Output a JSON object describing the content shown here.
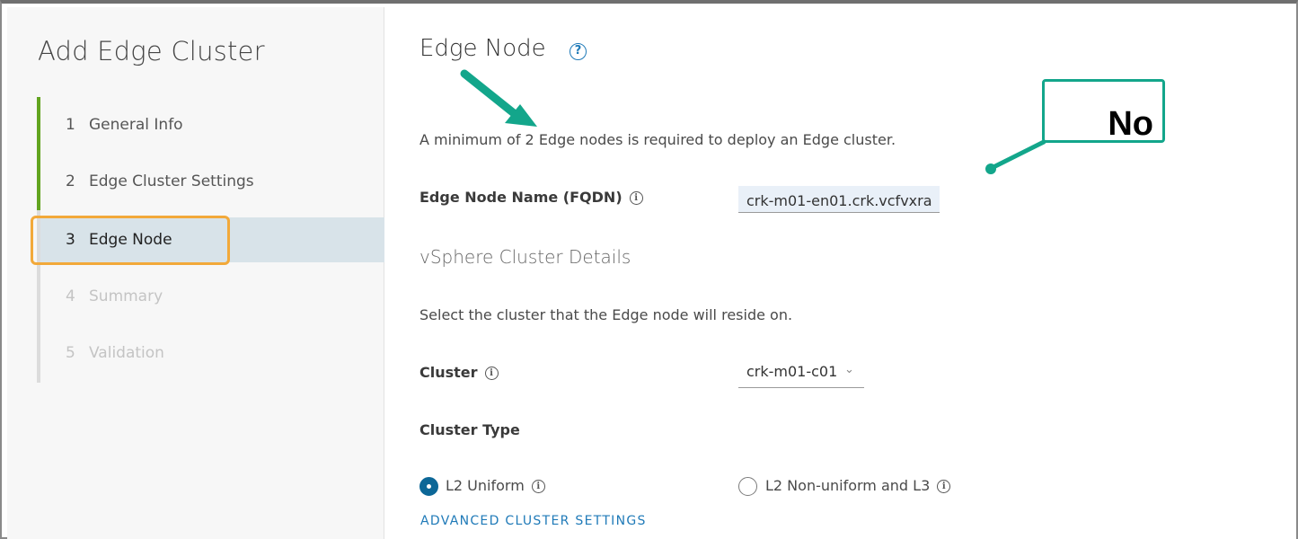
{
  "wizard": {
    "title": "Add Edge Cluster",
    "steps": [
      {
        "num": "1",
        "label": "General Info",
        "state": "completed"
      },
      {
        "num": "2",
        "label": "Edge Cluster Settings",
        "state": "completed"
      },
      {
        "num": "3",
        "label": "Edge Node",
        "state": "active"
      },
      {
        "num": "4",
        "label": "Summary",
        "state": "disabled"
      },
      {
        "num": "5",
        "label": "Validation",
        "state": "disabled"
      }
    ]
  },
  "main": {
    "title": "Edge Node",
    "help_icon": "?",
    "min_text": "A minimum of 2 Edge nodes is required to deploy an Edge cluster.",
    "fqdn_label": "Edge Node Name (FQDN)",
    "fqdn_value": "crk-m01-en01.crk.vcfvxra",
    "vsphere_title": "vSphere Cluster Details",
    "select_text": "Select the cluster that the Edge node will reside on.",
    "cluster_label": "Cluster",
    "cluster_value": "crk-m01-c01",
    "cluster_type_label": "Cluster Type",
    "radio_l2_uniform": "L2 Uniform",
    "radio_l2_nonuniform": "L2 Non-uniform and L3",
    "advanced_link": "ADVANCED CLUSTER SETTINGS"
  },
  "annotation": {
    "callout_text": "No",
    "color": "#13a68b",
    "highlight_color": "#f2a93a"
  },
  "colors": {
    "completed_step": "#62a420",
    "active_step_bg": "#d8e3e9",
    "link": "#1f7ab8",
    "radio_checked": "#0c6797"
  }
}
